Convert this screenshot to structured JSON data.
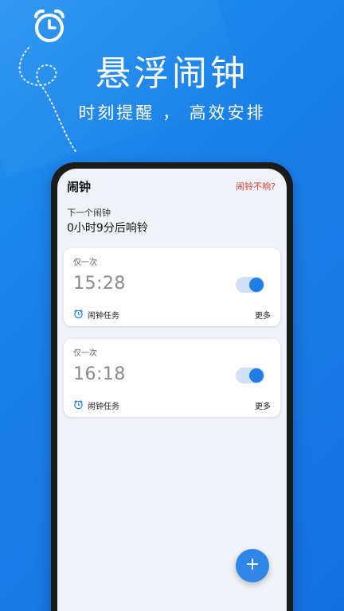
{
  "promo": {
    "title": "悬浮闹钟",
    "subtitle": "时刻提醒 ， 高效安排"
  },
  "app": {
    "title": "闹钟",
    "help_link": "闹铃不响?",
    "next_alarm_label": "下一个闹钟",
    "next_alarm_value": "0小时9分后响铃"
  },
  "alarms": [
    {
      "repeat": "仅一次",
      "time": "15:28",
      "enabled": true,
      "task_label": "闹钟任务",
      "more_label": "更多"
    },
    {
      "repeat": "仅一次",
      "time": "16:18",
      "enabled": true,
      "task_label": "闹钟任务",
      "more_label": "更多"
    }
  ],
  "fab": {
    "label": "+"
  },
  "colors": {
    "background": "#1a7ee8",
    "accent": "#1f7fe6",
    "warning_text": "#e53935",
    "screen_bg": "#f0f4f8"
  },
  "icons": [
    "alarm-clock-icon",
    "task-clock-icon",
    "plus-icon"
  ]
}
